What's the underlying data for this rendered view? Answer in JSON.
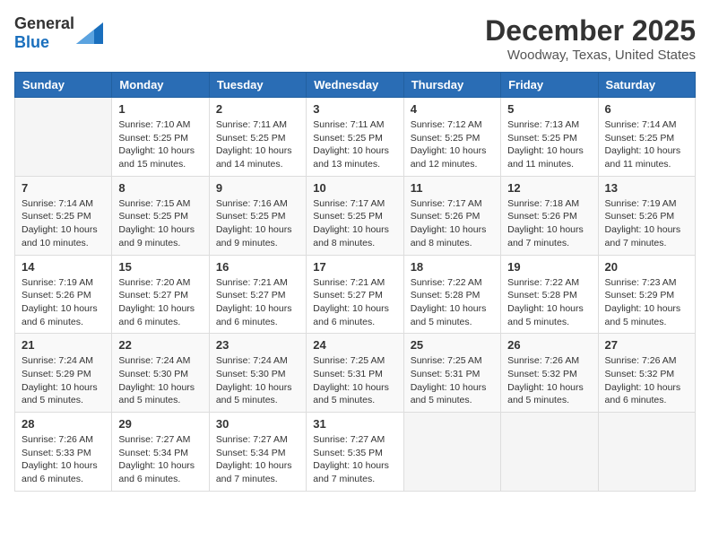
{
  "header": {
    "logo_general": "General",
    "logo_blue": "Blue",
    "month": "December 2025",
    "location": "Woodway, Texas, United States"
  },
  "weekdays": [
    "Sunday",
    "Monday",
    "Tuesday",
    "Wednesday",
    "Thursday",
    "Friday",
    "Saturday"
  ],
  "weeks": [
    [
      {
        "day": "",
        "info": ""
      },
      {
        "day": "1",
        "info": "Sunrise: 7:10 AM\nSunset: 5:25 PM\nDaylight: 10 hours\nand 15 minutes."
      },
      {
        "day": "2",
        "info": "Sunrise: 7:11 AM\nSunset: 5:25 PM\nDaylight: 10 hours\nand 14 minutes."
      },
      {
        "day": "3",
        "info": "Sunrise: 7:11 AM\nSunset: 5:25 PM\nDaylight: 10 hours\nand 13 minutes."
      },
      {
        "day": "4",
        "info": "Sunrise: 7:12 AM\nSunset: 5:25 PM\nDaylight: 10 hours\nand 12 minutes."
      },
      {
        "day": "5",
        "info": "Sunrise: 7:13 AM\nSunset: 5:25 PM\nDaylight: 10 hours\nand 11 minutes."
      },
      {
        "day": "6",
        "info": "Sunrise: 7:14 AM\nSunset: 5:25 PM\nDaylight: 10 hours\nand 11 minutes."
      }
    ],
    [
      {
        "day": "7",
        "info": "Sunrise: 7:14 AM\nSunset: 5:25 PM\nDaylight: 10 hours\nand 10 minutes."
      },
      {
        "day": "8",
        "info": "Sunrise: 7:15 AM\nSunset: 5:25 PM\nDaylight: 10 hours\nand 9 minutes."
      },
      {
        "day": "9",
        "info": "Sunrise: 7:16 AM\nSunset: 5:25 PM\nDaylight: 10 hours\nand 9 minutes."
      },
      {
        "day": "10",
        "info": "Sunrise: 7:17 AM\nSunset: 5:25 PM\nDaylight: 10 hours\nand 8 minutes."
      },
      {
        "day": "11",
        "info": "Sunrise: 7:17 AM\nSunset: 5:26 PM\nDaylight: 10 hours\nand 8 minutes."
      },
      {
        "day": "12",
        "info": "Sunrise: 7:18 AM\nSunset: 5:26 PM\nDaylight: 10 hours\nand 7 minutes."
      },
      {
        "day": "13",
        "info": "Sunrise: 7:19 AM\nSunset: 5:26 PM\nDaylight: 10 hours\nand 7 minutes."
      }
    ],
    [
      {
        "day": "14",
        "info": "Sunrise: 7:19 AM\nSunset: 5:26 PM\nDaylight: 10 hours\nand 6 minutes."
      },
      {
        "day": "15",
        "info": "Sunrise: 7:20 AM\nSunset: 5:27 PM\nDaylight: 10 hours\nand 6 minutes."
      },
      {
        "day": "16",
        "info": "Sunrise: 7:21 AM\nSunset: 5:27 PM\nDaylight: 10 hours\nand 6 minutes."
      },
      {
        "day": "17",
        "info": "Sunrise: 7:21 AM\nSunset: 5:27 PM\nDaylight: 10 hours\nand 6 minutes."
      },
      {
        "day": "18",
        "info": "Sunrise: 7:22 AM\nSunset: 5:28 PM\nDaylight: 10 hours\nand 5 minutes."
      },
      {
        "day": "19",
        "info": "Sunrise: 7:22 AM\nSunset: 5:28 PM\nDaylight: 10 hours\nand 5 minutes."
      },
      {
        "day": "20",
        "info": "Sunrise: 7:23 AM\nSunset: 5:29 PM\nDaylight: 10 hours\nand 5 minutes."
      }
    ],
    [
      {
        "day": "21",
        "info": "Sunrise: 7:24 AM\nSunset: 5:29 PM\nDaylight: 10 hours\nand 5 minutes."
      },
      {
        "day": "22",
        "info": "Sunrise: 7:24 AM\nSunset: 5:30 PM\nDaylight: 10 hours\nand 5 minutes."
      },
      {
        "day": "23",
        "info": "Sunrise: 7:24 AM\nSunset: 5:30 PM\nDaylight: 10 hours\nand 5 minutes."
      },
      {
        "day": "24",
        "info": "Sunrise: 7:25 AM\nSunset: 5:31 PM\nDaylight: 10 hours\nand 5 minutes."
      },
      {
        "day": "25",
        "info": "Sunrise: 7:25 AM\nSunset: 5:31 PM\nDaylight: 10 hours\nand 5 minutes."
      },
      {
        "day": "26",
        "info": "Sunrise: 7:26 AM\nSunset: 5:32 PM\nDaylight: 10 hours\nand 5 minutes."
      },
      {
        "day": "27",
        "info": "Sunrise: 7:26 AM\nSunset: 5:32 PM\nDaylight: 10 hours\nand 6 minutes."
      }
    ],
    [
      {
        "day": "28",
        "info": "Sunrise: 7:26 AM\nSunset: 5:33 PM\nDaylight: 10 hours\nand 6 minutes."
      },
      {
        "day": "29",
        "info": "Sunrise: 7:27 AM\nSunset: 5:34 PM\nDaylight: 10 hours\nand 6 minutes."
      },
      {
        "day": "30",
        "info": "Sunrise: 7:27 AM\nSunset: 5:34 PM\nDaylight: 10 hours\nand 7 minutes."
      },
      {
        "day": "31",
        "info": "Sunrise: 7:27 AM\nSunset: 5:35 PM\nDaylight: 10 hours\nand 7 minutes."
      },
      {
        "day": "",
        "info": ""
      },
      {
        "day": "",
        "info": ""
      },
      {
        "day": "",
        "info": ""
      }
    ]
  ]
}
